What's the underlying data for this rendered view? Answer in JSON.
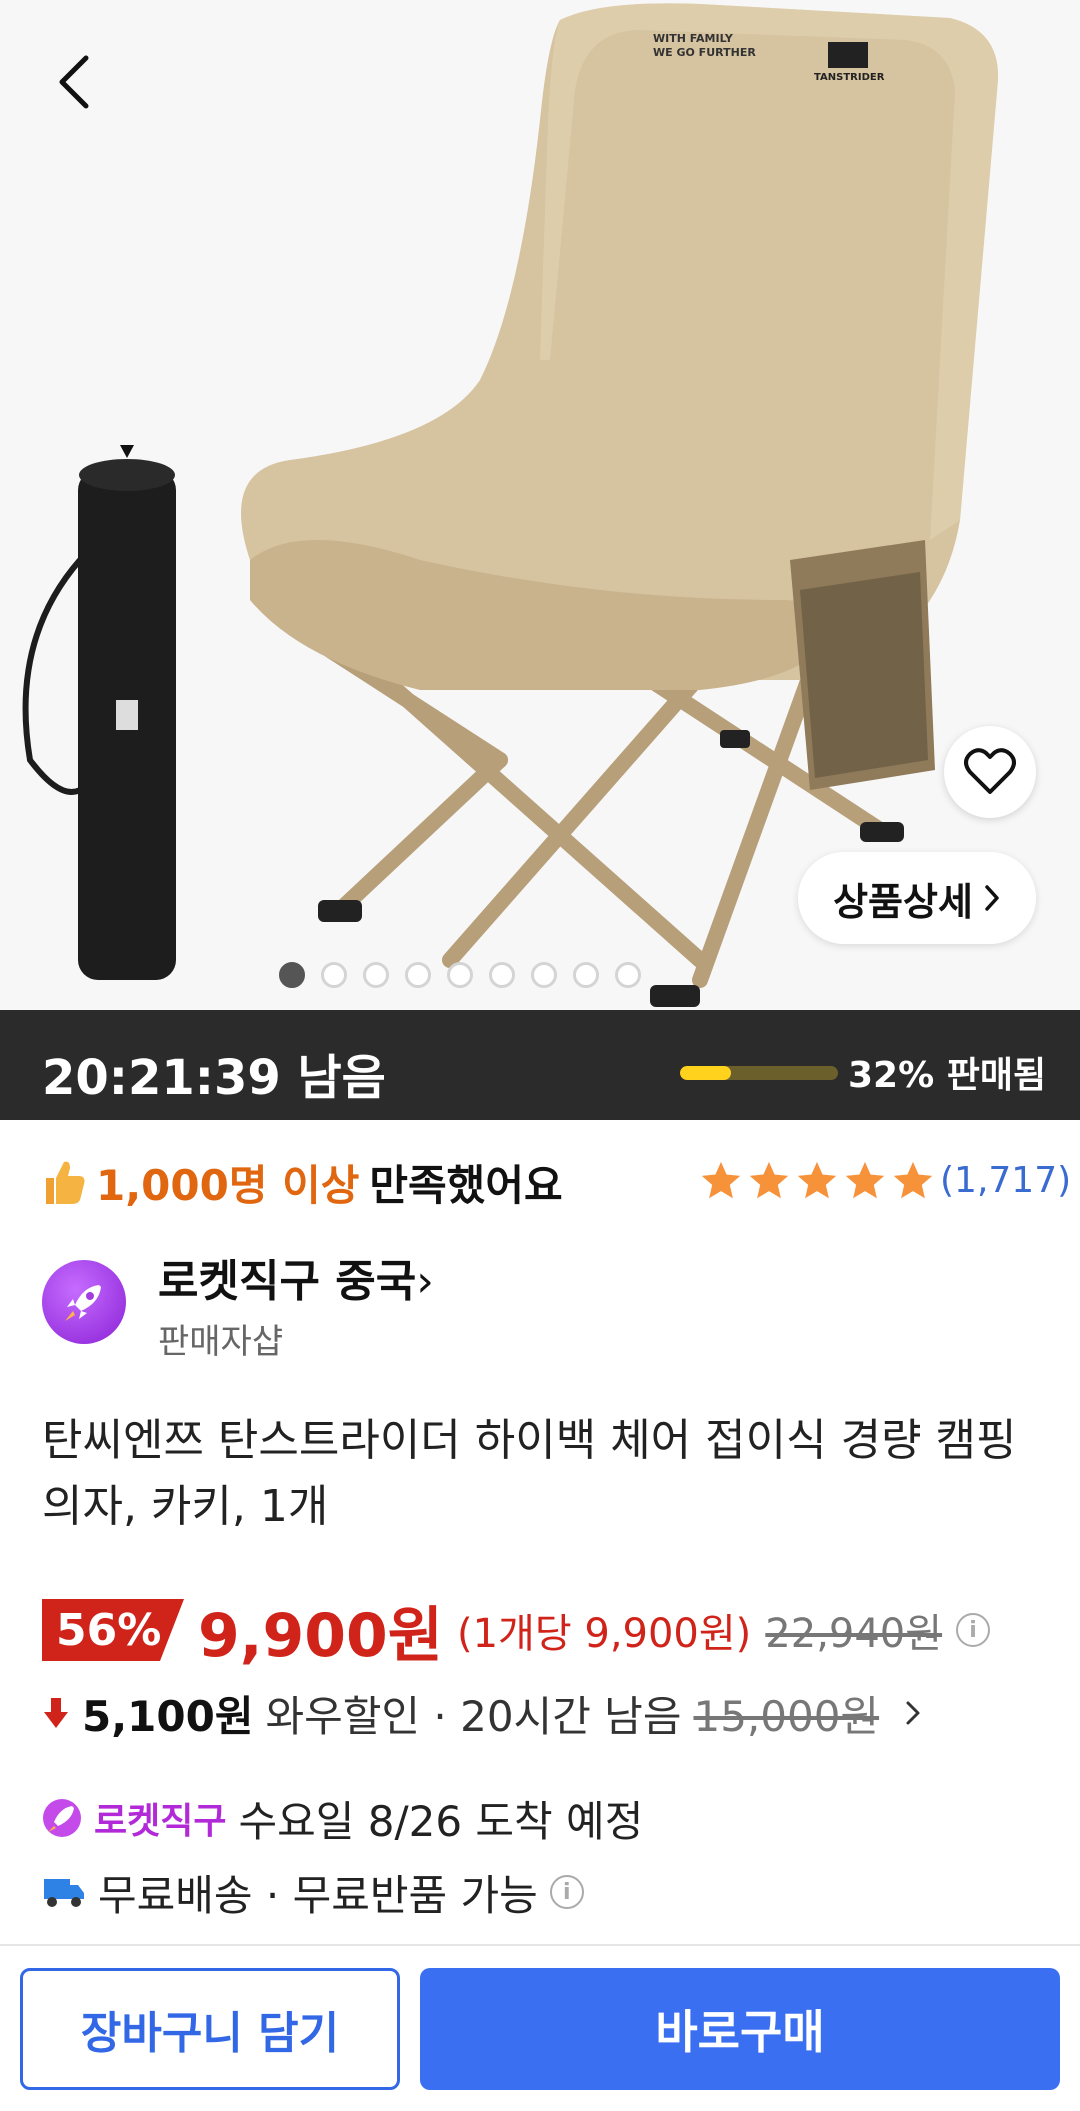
{
  "hero": {
    "detail_label": "상품상세",
    "image_count": 9,
    "active_index": 0,
    "chair_top_text": "WITH FAMILY WE GO FURTHER",
    "brand_text": "TANSTRIDER"
  },
  "deal": {
    "time_left": "20:21:39 남음",
    "sold_percent": 32,
    "sold_label": "32% 판매됨"
  },
  "satisfaction": {
    "highlight": "1,000명 이상",
    "text": "만족했어요",
    "rating_stars": 5,
    "rating_count": "(1,717)"
  },
  "seller": {
    "name": "로켓직구 중국",
    "sub": "판매자샵"
  },
  "product": {
    "title": "탄씨엔쯔 탄스트라이더 하이백 체어 접이식 경량 캠핑의자, 카키, 1개"
  },
  "price": {
    "discount": "56%",
    "current": "9,900원",
    "unit_price": "(1개당 9,900원)",
    "original": "22,940원"
  },
  "wow": {
    "amount": "5,100원",
    "text": "와우할인 · 20시간 남음",
    "original": "15,000원"
  },
  "delivery": {
    "brand": "로켓직구",
    "arrival": "수요일 8/26 도착 예정",
    "free": "무료배송 · 무료반품 가능"
  },
  "actions": {
    "cart": "장바구니 담기",
    "buy": "바로구매"
  },
  "colors": {
    "accent_blue": "#3a6ff2",
    "price_red": "#d0241b",
    "highlight_orange": "#e0660f",
    "rocket_purple": "#b22ad8"
  }
}
